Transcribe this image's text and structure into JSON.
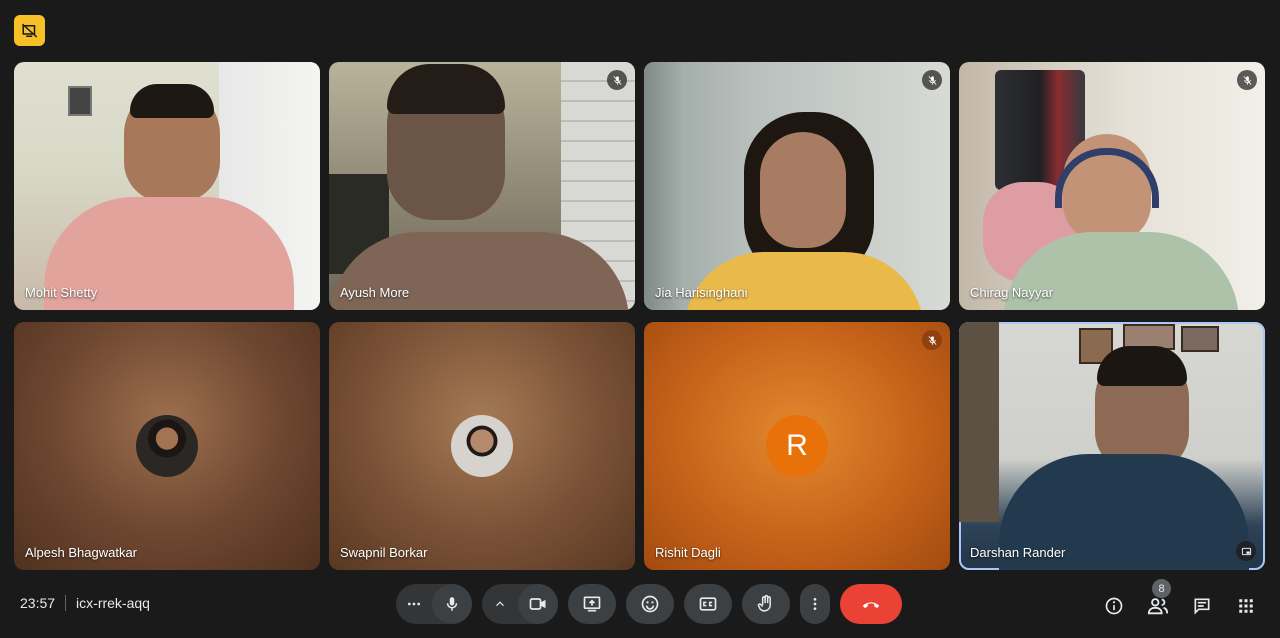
{
  "meeting": {
    "time": "23:57",
    "code": "icx-rrek-aqq",
    "participant_count": "8"
  },
  "participants": [
    {
      "name": "Mohit Shetty",
      "muted": false
    },
    {
      "name": "Ayush More",
      "muted": true
    },
    {
      "name": "Jia Harisinghani",
      "muted": true
    },
    {
      "name": "Chirag Nayyar",
      "muted": true
    },
    {
      "name": "Alpesh Bhagwatkar",
      "muted": false
    },
    {
      "name": "Swapnil Borkar",
      "muted": false
    },
    {
      "name": "Rishit Dagli",
      "muted": true,
      "initial": "R"
    },
    {
      "name": "Darshan Rander",
      "muted": false,
      "active": true
    }
  ],
  "controls": {
    "more_options": "more-options-icon",
    "microphone": "microphone-icon",
    "camera": "camera-icon",
    "present": "present-screen-icon",
    "reactions": "emoji-icon",
    "captions": "captions-icon",
    "raise_hand": "hand-icon",
    "end_call": "end-call-icon"
  },
  "colors": {
    "accent_yellow": "#f6c026",
    "end_call": "#ea4335",
    "avatar_orange": "#e8710a",
    "active_border": "#a8c7fa"
  }
}
